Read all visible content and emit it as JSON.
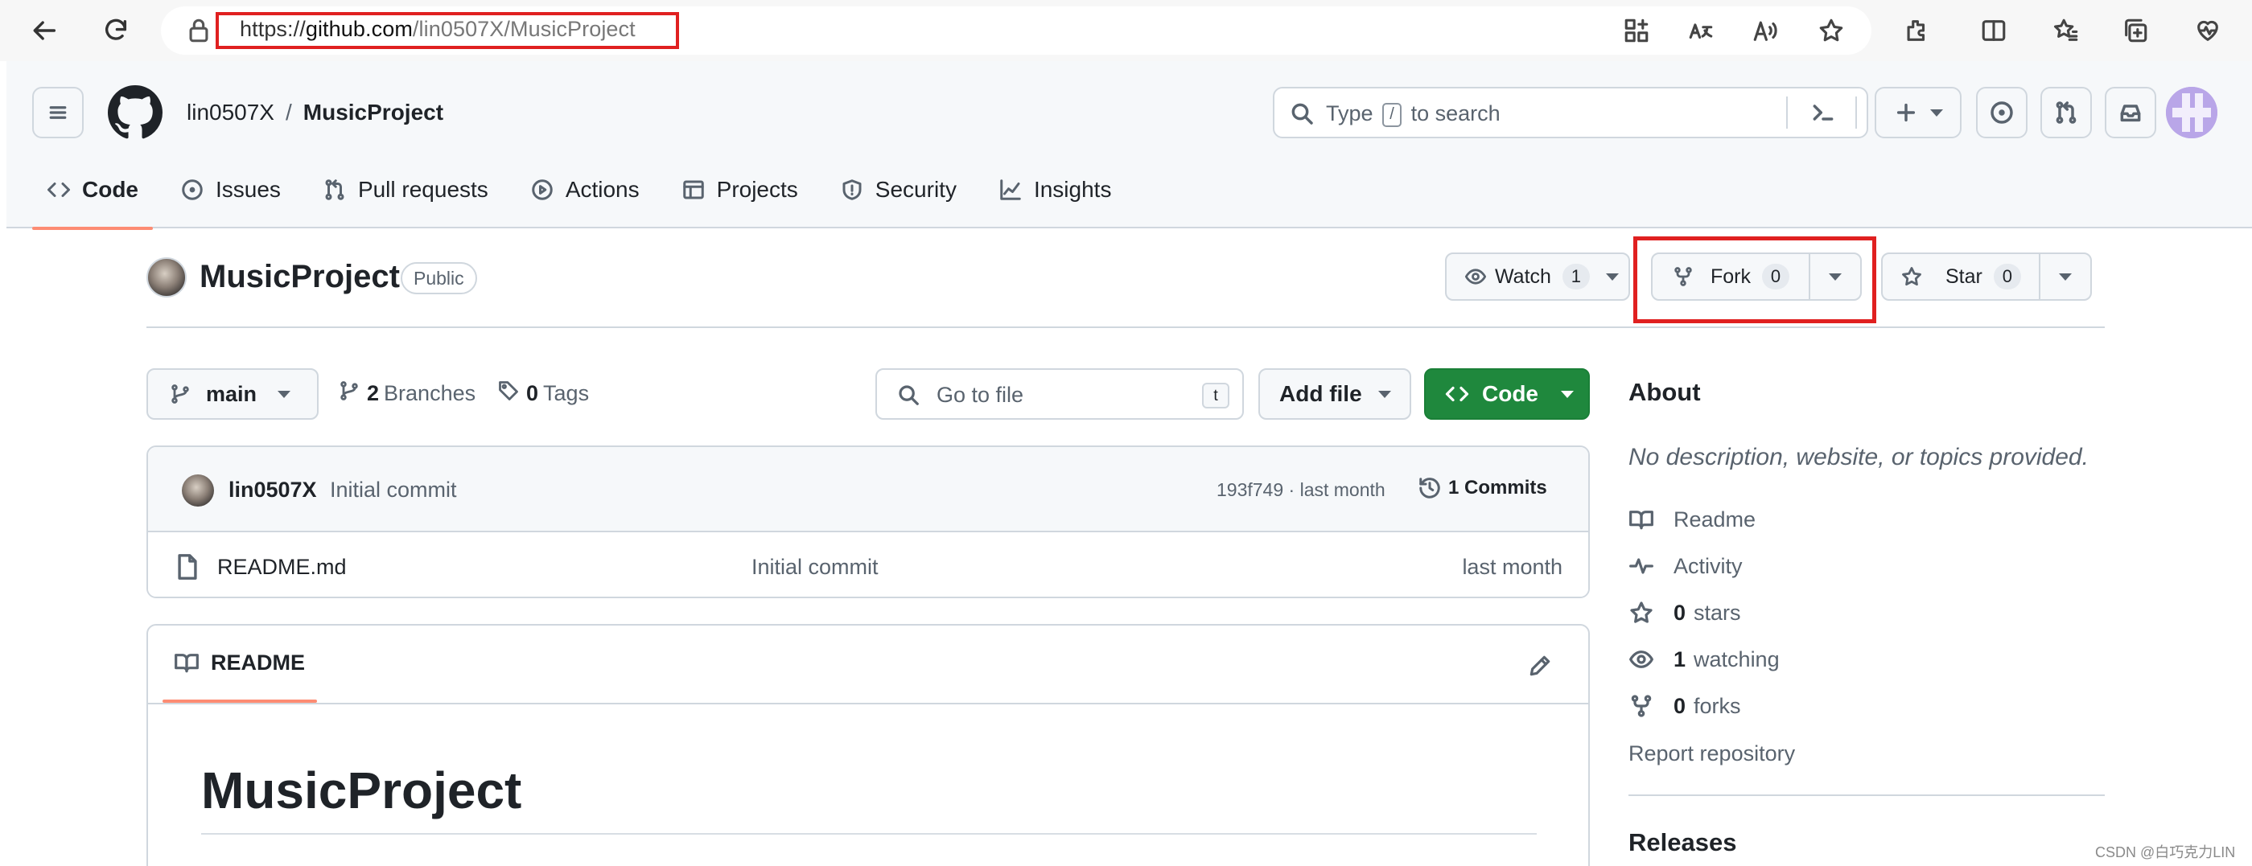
{
  "browser": {
    "url_scheme": "https://",
    "url_host": "github.com",
    "url_path": "/lin0507X/MusicProject",
    "accent_highlight": "#e02020"
  },
  "header": {
    "owner": "lin0507X",
    "separator": "/",
    "repo": "MusicProject",
    "search": {
      "prefix": "Type",
      "key": "/",
      "suffix": "to search"
    }
  },
  "repo_nav": {
    "tabs": [
      {
        "label": "Code",
        "icon": "code-icon"
      },
      {
        "label": "Issues",
        "icon": "issue-icon"
      },
      {
        "label": "Pull requests",
        "icon": "pull-request-icon"
      },
      {
        "label": "Actions",
        "icon": "play-icon"
      },
      {
        "label": "Projects",
        "icon": "table-icon"
      },
      {
        "label": "Security",
        "icon": "shield-icon"
      },
      {
        "label": "Insights",
        "icon": "graph-icon"
      }
    ]
  },
  "repo_head": {
    "title": "MusicProject",
    "visibility": "Public",
    "watch": {
      "label": "Watch",
      "count": "1"
    },
    "fork": {
      "label": "Fork",
      "count": "0"
    },
    "star": {
      "label": "Star",
      "count": "0"
    }
  },
  "toolbar": {
    "branch": "main",
    "branches_count": "2",
    "branches_label": "Branches",
    "tags_count": "0",
    "tags_label": "Tags",
    "goto_placeholder": "Go to file",
    "goto_key": "t",
    "add_file": "Add file",
    "code": "Code",
    "code_color": "#1f883d"
  },
  "latest_commit": {
    "author": "lin0507X",
    "message": "Initial commit",
    "hash_time": "193f749 · last month",
    "commits_count": "1",
    "commits_label": "Commits"
  },
  "files": [
    {
      "name": "README.md",
      "commit": "Initial commit",
      "date": "last month"
    }
  ],
  "readme": {
    "tab": "README",
    "heading": "MusicProject"
  },
  "about": {
    "title": "About",
    "description": "No description, website, or topics provided.",
    "readme": "Readme",
    "activity": "Activity",
    "stars_count": "0",
    "stars_label": "stars",
    "watching_count": "1",
    "watching_label": "watching",
    "forks_count": "0",
    "forks_label": "forks",
    "report": "Report repository",
    "releases": "Releases"
  },
  "watermark": "CSDN @白巧克力LIN"
}
